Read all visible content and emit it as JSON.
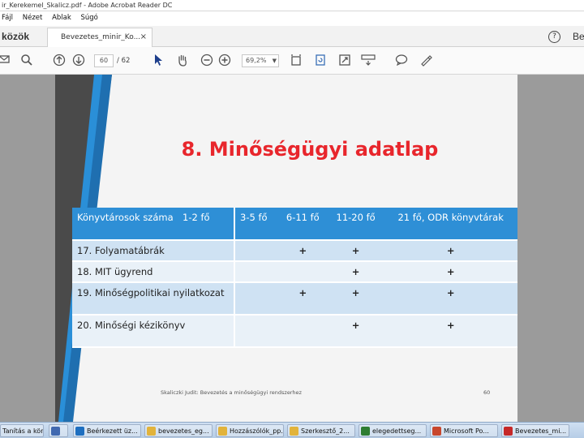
{
  "window": {
    "title": "ir_Kerekemel_Skalicz.pdf - Adobe Acrobat Reader DC"
  },
  "menu": [
    "Fájl",
    "Nézet",
    "Ablak",
    "Súgó"
  ],
  "tabs": {
    "tools": "közök",
    "document": "Bevezetes_minir_Ko...",
    "document_close": "×",
    "account": "Be"
  },
  "toolbar": {
    "page_current": "60",
    "page_total": "/ 62",
    "zoom": "69,2%"
  },
  "slide": {
    "title": "8. Minőségügyi adatlap",
    "table": {
      "headers": [
        "Könyvtárosok száma",
        "1-2 fő",
        "3-5 fő",
        "6-11 fő",
        "11-20 fő",
        "21 fő, ODR könyvtárak"
      ],
      "rows": [
        {
          "label": "17. Folyamatábrák",
          "marks": [
            "",
            "",
            "+",
            "+",
            "+"
          ]
        },
        {
          "label": "18. MIT ügyrend",
          "marks": [
            "",
            "",
            "",
            "+",
            "+"
          ]
        },
        {
          "label": "19. Minőségpolitikai nyilatkozat",
          "marks": [
            "",
            "",
            "+",
            "+",
            "+"
          ]
        },
        {
          "label": "20. Minőségi kézikönyv",
          "marks": [
            "",
            "",
            "",
            "+",
            "+"
          ]
        }
      ]
    },
    "footer": "Skaliczki Judit: Bevezetés a minőségügyi rendszerhez",
    "page_number": "60"
  },
  "taskbar": [
    {
      "label": "Tanítás a köny...",
      "color": "#2b5797"
    },
    {
      "label": "Beérkezett üz...",
      "color": "#1e6fc0"
    },
    {
      "label": "bevezetes_eg...",
      "color": "#e2b33b"
    },
    {
      "label": "Hozzászólók_pp...",
      "color": "#e2b33b"
    },
    {
      "label": "Szerkesztő_2...",
      "color": "#e2b33b"
    },
    {
      "label": "elegedettseg...",
      "color": "#2e7d32"
    },
    {
      "label": "Microsoft Po...",
      "color": "#c8462c"
    },
    {
      "label": "Bevezetes_mi...",
      "color": "#c62828"
    }
  ],
  "colors": {
    "title_red": "#e8262c",
    "header_blue": "#2e8fd6",
    "row_blue": "#cfe2f3",
    "row_light": "#e9f1f8"
  }
}
